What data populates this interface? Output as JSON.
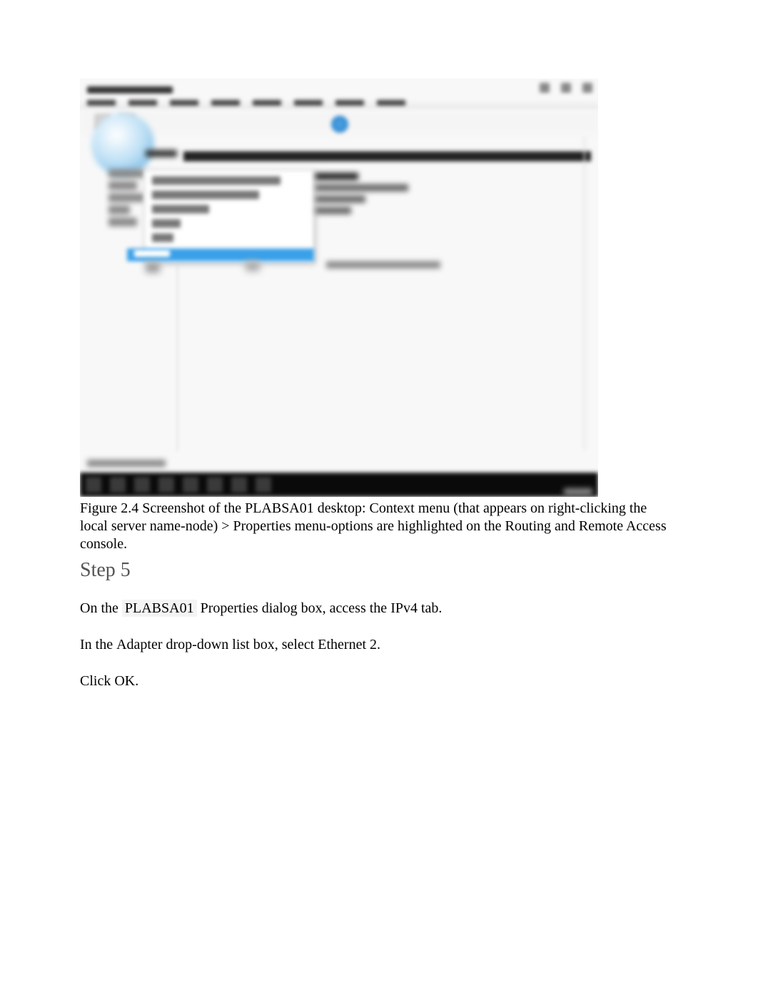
{
  "figure": {
    "caption": "Figure 2.4 Screenshot of the PLABSA01 desktop: Context menu (that appears on right-clicking the local server name-node) > Properties menu-options are highlighted on the Routing and Remote Access console."
  },
  "step": {
    "heading": "Step 5"
  },
  "instructions": {
    "line1_prefix": "On the ",
    "line1_server": "PLABSA01",
    "line1_properties": " Properties",
    "line1_middle": " dialog box, access the ",
    "line1_tab": "IPv4",
    "line1_suffix": " tab.",
    "line2_prefix": "In the ",
    "line2_adapter": "Adapter",
    "line2_middle": " drop-down list box, select ",
    "line2_ethernet": "Ethernet 2.",
    "line3": "Click OK."
  }
}
